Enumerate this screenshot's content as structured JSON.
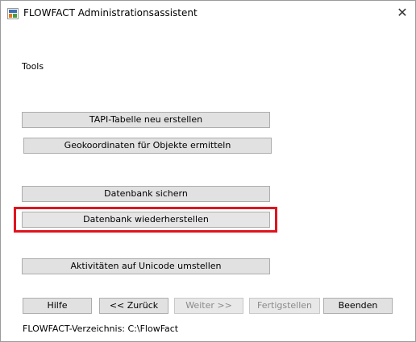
{
  "window": {
    "title": "FLOWFACT Administrationsassistent",
    "close_glyph": "✕"
  },
  "section": {
    "label": "Tools"
  },
  "tools": {
    "tapi": "TAPI-Tabelle neu erstellen",
    "geo": "Geokoordinaten für Objekte ermitteln",
    "backup": "Datenbank sichern",
    "restore": "Datenbank wiederherstellen",
    "unicode": "Aktivitäten auf Unicode umstellen"
  },
  "nav": {
    "help": "Hilfe",
    "back": "<< Zurück",
    "next": "Weiter >>",
    "finish": "Fertigstellen",
    "exit": "Beenden"
  },
  "footer": {
    "directory": "FLOWFACT-Verzeichnis: C:\\FlowFact"
  },
  "colors": {
    "highlight": "#e0141e",
    "button_bg": "#e1e1e1",
    "disabled_text": "#8a8a8a"
  },
  "icons": {
    "app": "flowfact-app-icon",
    "close": "close-icon"
  }
}
